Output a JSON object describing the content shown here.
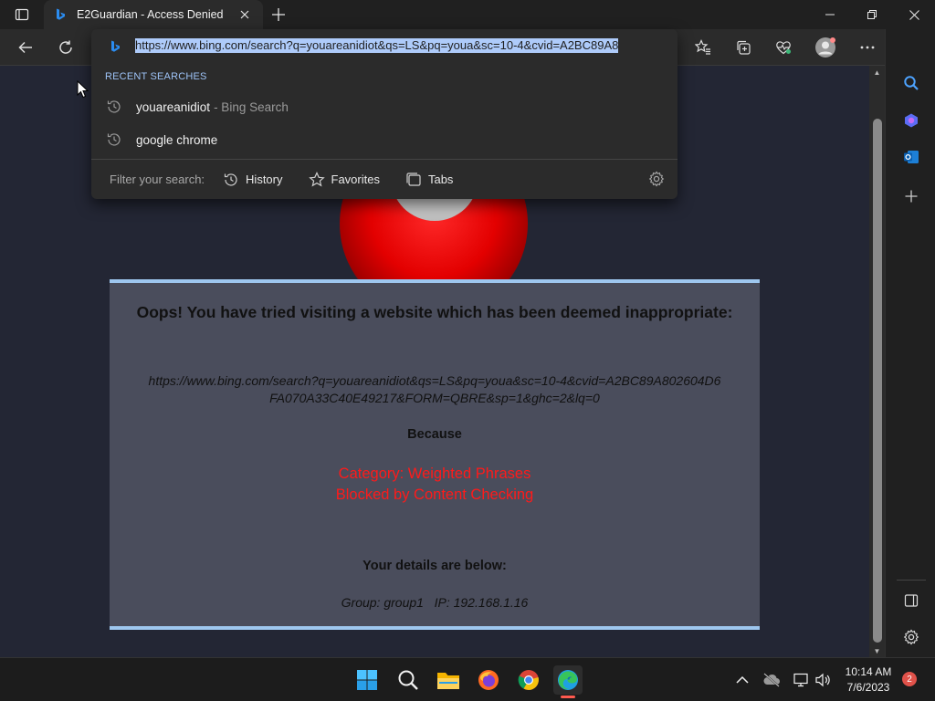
{
  "tab": {
    "title": "E2Guardian - Access Denied"
  },
  "address_bar": {
    "url": "https://www.bing.com/search?q=youareanidiot&qs=LS&pq=youa&sc=10-4&cvid=A2BC89A8"
  },
  "dropdown": {
    "recent_header": "RECENT SEARCHES",
    "suggestions": [
      {
        "text": "youareanidiot",
        "source": "- Bing Search"
      },
      {
        "text": "google chrome",
        "source": ""
      }
    ],
    "filter_label": "Filter your search:",
    "filters": [
      "History",
      "Favorites",
      "Tabs"
    ]
  },
  "page": {
    "title": "Oops! You have tried visiting a website which has been deemed inappropriate:",
    "blocked_url_line1": "https://www.bing.com/search?q=youareanidiot&qs=LS&pq=youa&sc=10-4&cvid=A2BC89A802604D6",
    "blocked_url_line2": "FA070A33C40E49217&FORM=QBRE&sp=1&ghc=2&lq=0",
    "because_label": "Because",
    "category_line1": "Category: Weighted Phrases",
    "category_line2": "Blocked by Content Checking",
    "details_label": "Your details are below:",
    "details": "Group: group1   IP: 192.168.1.16"
  },
  "taskbar": {
    "time": "10:14 AM",
    "date": "7/6/2023",
    "notification_count": "2"
  },
  "colors": {
    "accent_highlight": "#aecbfa",
    "page_background": "#232634",
    "message_box": "#4a4d5c",
    "message_border": "#9ec7ef",
    "category_red": "#ff1a1a"
  },
  "icons": [
    "tab-actions-icon",
    "bing-icon",
    "close-icon",
    "plus-icon",
    "minimize-icon",
    "restore-icon",
    "back-arrow-icon",
    "refresh-icon",
    "star-list-icon",
    "collections-icon",
    "heartbeat-icon",
    "profile-avatar-icon",
    "more-icon",
    "copilot-icon",
    "history-clock-icon",
    "favorites-star-icon",
    "tabs-icon",
    "gear-icon",
    "search-icon",
    "designer-icon",
    "outlook-icon",
    "split-screen-icon",
    "windows-start-icon",
    "file-explorer-icon",
    "firefox-icon",
    "chrome-icon",
    "edge-icon",
    "chevron-up-icon",
    "cloud-offline-icon",
    "network-icon",
    "volume-icon"
  ]
}
